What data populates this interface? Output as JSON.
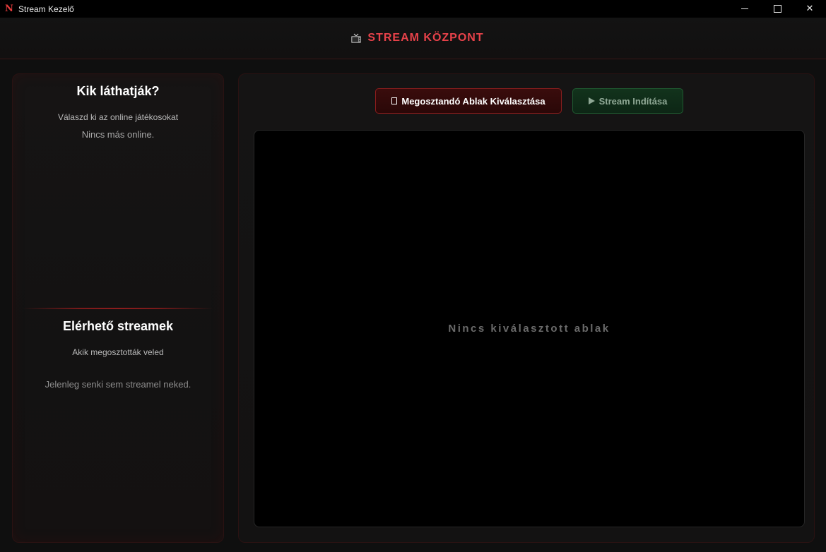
{
  "window": {
    "title": "Stream Kezelő",
    "app_icon_letter": "N",
    "controls": {
      "minimize": "minimize-icon",
      "maximize": "maximize-icon",
      "close_glyph": "✕"
    }
  },
  "header": {
    "icon": "tv-icon",
    "title": "STREAM KÖZPONT"
  },
  "left_panel": {
    "viewers_section": {
      "title": "Kik láthatják?",
      "subtitle": "Válaszd ki az online játékosokat",
      "empty_note": "Nincs más online."
    },
    "streams_section": {
      "title": "Elérhető streamek",
      "subtitle": "Akik megosztották veled",
      "empty_note": "Jelenleg senki sem streamel neked."
    }
  },
  "right_panel": {
    "select_window_button": {
      "icon": "window-icon",
      "label": "Megosztandó Ablak Kiválasztása"
    },
    "start_stream_button": {
      "icon": "play-icon",
      "label": "Stream Indítása"
    },
    "preview": {
      "placeholder": "Nincs kiválasztott ablak"
    }
  },
  "colors": {
    "accent_red": "#e8424a",
    "select_button_bg": "#3a0c0c",
    "start_button_bg": "#12331c",
    "background": "#0f0f0f"
  }
}
